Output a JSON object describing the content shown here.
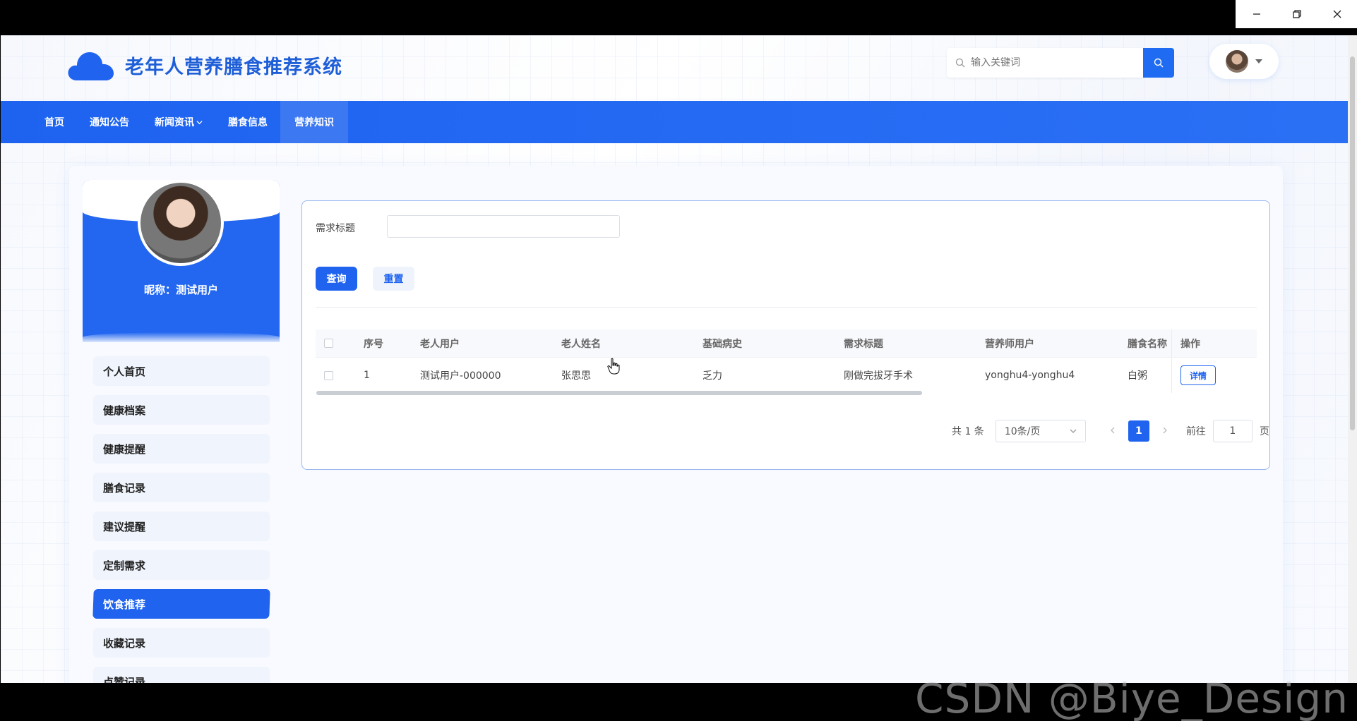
{
  "window": {
    "minimize_icon": "minimize-icon",
    "restore_icon": "restore-icon",
    "close_icon": "close-icon"
  },
  "header": {
    "title": "老年人营养膳食推荐系统",
    "logo_icon": "cloud-icon",
    "search_placeholder": "输入关键词",
    "search_icon": "search-icon"
  },
  "nav": {
    "items": [
      {
        "label": "首页"
      },
      {
        "label": "通知公告"
      },
      {
        "label": "新闻资讯"
      },
      {
        "label": "膳食信息"
      },
      {
        "label": "营养知识"
      }
    ]
  },
  "profile": {
    "nickname": "昵称：测试用户"
  },
  "sidebar": {
    "items": [
      {
        "label": "个人首页"
      },
      {
        "label": "健康档案"
      },
      {
        "label": "健康提醒"
      },
      {
        "label": "膳食记录"
      },
      {
        "label": "建议提醒"
      },
      {
        "label": "定制需求"
      },
      {
        "label": "饮食推荐"
      },
      {
        "label": "收藏记录"
      },
      {
        "label": "点赞记录"
      }
    ]
  },
  "filter": {
    "label": "需求标题",
    "query_button": "查询",
    "reset_button": "重置"
  },
  "table": {
    "columns": [
      "序号",
      "老人用户",
      "老人姓名",
      "基础病史",
      "需求标题",
      "营养师用户",
      "膳食名称",
      "操作"
    ],
    "rows": [
      {
        "idx": "1",
        "user": "测试用户-000000",
        "name": "张思思",
        "history": "乏力",
        "title": "刚做完拔牙手术",
        "dietitian": "yonghu4-yonghu4",
        "food": "白粥",
        "action": "详情"
      }
    ]
  },
  "pagination": {
    "total": "共 1 条",
    "page_size": "10条/页",
    "current": "1",
    "goto_label": "前往",
    "goto_value": "1",
    "page_suffix": "页"
  },
  "watermark": "CSDN @Biye_Design"
}
